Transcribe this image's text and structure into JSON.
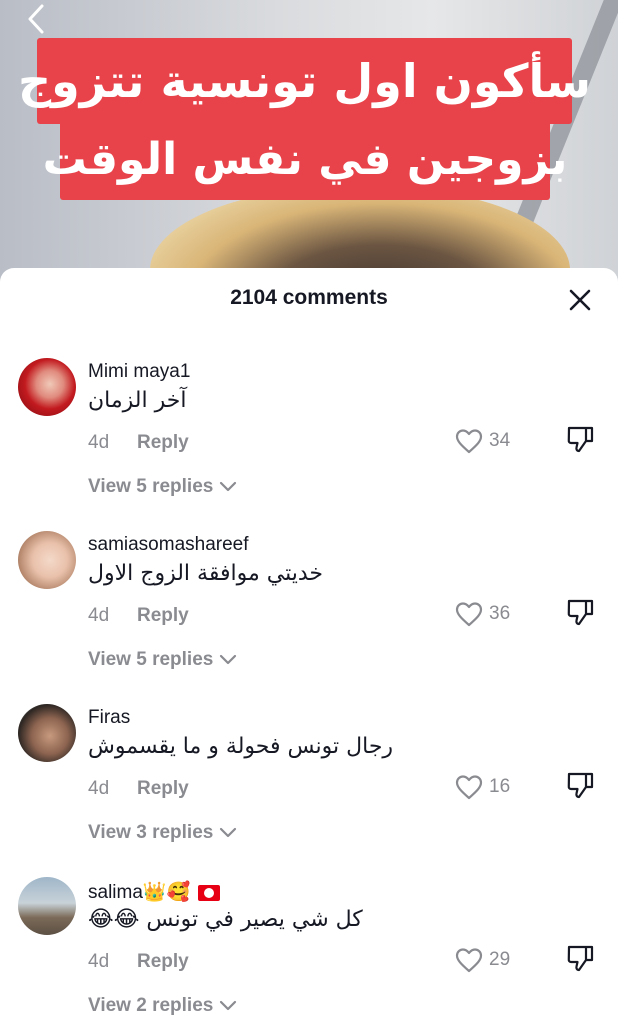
{
  "video": {
    "banner_line1": "سأكون اول تونسية تتزوج",
    "banner_line2": "بزوجين في نفس الوقت"
  },
  "sheet": {
    "title": "2104 comments"
  },
  "comments": [
    {
      "username": "Mimi maya1",
      "text": "آخر الزمان",
      "age": "4d",
      "reply_label": "Reply",
      "likes": "34",
      "view_replies": "View 5 replies"
    },
    {
      "username": "samiasomashareef",
      "text": "خديتي موافقة الزوج الاول",
      "age": "4d",
      "reply_label": "Reply",
      "likes": "36",
      "view_replies": "View 5 replies"
    },
    {
      "username": "Firas",
      "text": "رجال تونس فحولة و ما يقسموش",
      "age": "4d",
      "reply_label": "Reply",
      "likes": "16",
      "view_replies": "View 3 replies"
    },
    {
      "username": "salima👑🥰",
      "text": "كل شي يصير في تونس 😂😂",
      "age": "4d",
      "reply_label": "Reply",
      "likes": "29",
      "view_replies": "View 2 replies"
    }
  ],
  "colors": {
    "banner": "#e8434a",
    "secondary_text": "#8a8b91",
    "primary_text": "#161823"
  },
  "icons": [
    "back-icon",
    "close-icon",
    "heart-icon",
    "dislike-icon",
    "chevron-down-icon",
    "tunisia-flag-icon"
  ]
}
